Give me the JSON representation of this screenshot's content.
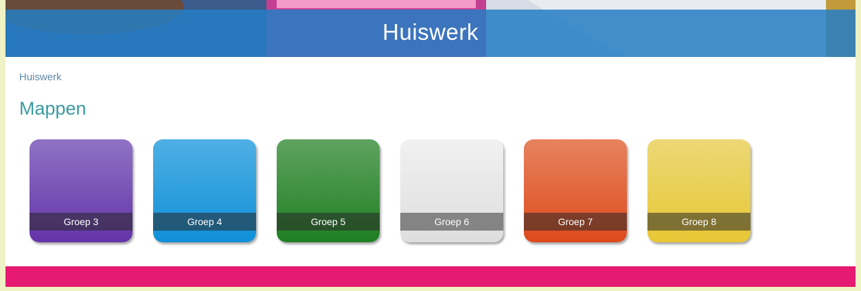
{
  "header": {
    "title": "Huiswerk"
  },
  "breadcrumb": {
    "current": "Huiswerk"
  },
  "section": {
    "title": "Mappen"
  },
  "folders": [
    {
      "label": "Groep 3",
      "color_top": "#8f72c5",
      "color_bottom": "#6434a8"
    },
    {
      "label": "Groep 4",
      "color_top": "#4fb0e4",
      "color_bottom": "#0f8fd8"
    },
    {
      "label": "Groep 5",
      "color_top": "#5fa360",
      "color_bottom": "#1f7f22"
    },
    {
      "label": "Groep 6",
      "color_top": "#f1f1f1",
      "color_bottom": "#dedede"
    },
    {
      "label": "Groep 7",
      "color_top": "#e7835f",
      "color_bottom": "#dd4a1c"
    },
    {
      "label": "Groep 8",
      "color_top": "#ecd876",
      "color_bottom": "#e7c734"
    }
  ],
  "colors": {
    "banner_overlay": "#257ec4",
    "footer": "#e61a73",
    "page_background": "#eef2c4",
    "section_title": "#3a9aa0"
  }
}
